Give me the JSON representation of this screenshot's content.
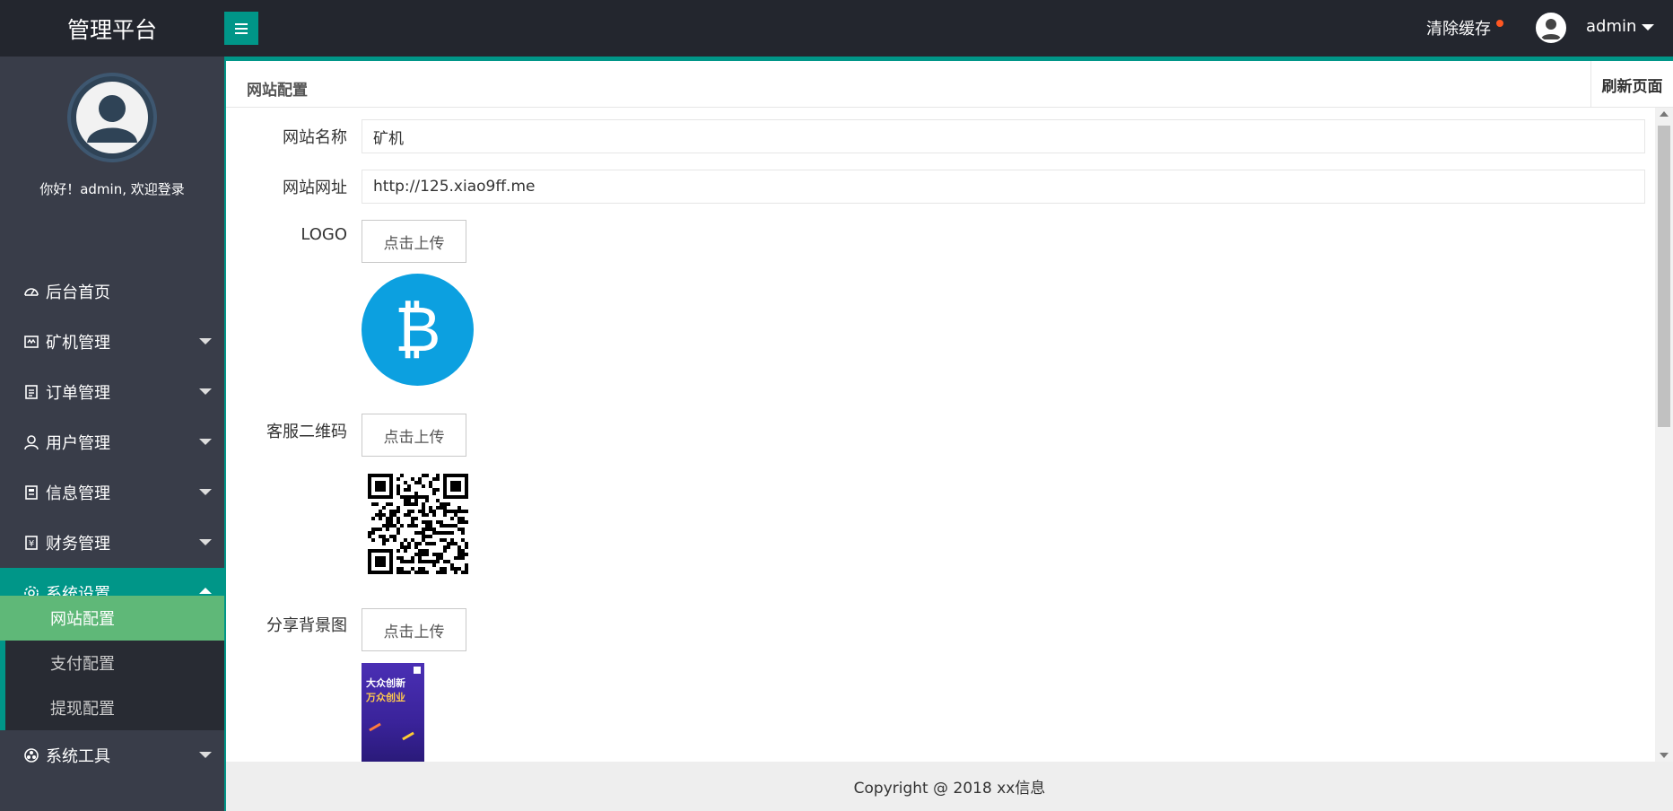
{
  "header": {
    "brand": "管理平台",
    "clear_cache": "清除缓存",
    "username": "admin",
    "menu_icon": "hamburger-icon",
    "accent_color": "#009688"
  },
  "sidebar": {
    "welcome": "你好！admin, 欢迎登录",
    "items": [
      {
        "label": "后台首页",
        "icon": "dashboard-icon"
      },
      {
        "label": "矿机管理",
        "icon": "miner-icon"
      },
      {
        "label": "订单管理",
        "icon": "order-icon"
      },
      {
        "label": "用户管理",
        "icon": "user-icon"
      },
      {
        "label": "信息管理",
        "icon": "info-icon"
      },
      {
        "label": "财务管理",
        "icon": "finance-icon"
      },
      {
        "label": "系统设置",
        "icon": "gear-icon"
      },
      {
        "label": "系统工具",
        "icon": "tools-icon"
      }
    ],
    "subitems": [
      {
        "label": "网站配置"
      },
      {
        "label": "支付配置"
      },
      {
        "label": "提现配置"
      }
    ]
  },
  "tab": {
    "title": "网站配置",
    "refresh": "刷新页面"
  },
  "form": {
    "site_name_label": "网站名称",
    "site_name_value": "矿机",
    "site_url_label": "网站网址",
    "site_url_value": "http://125.xiao9ff.me",
    "logo_label": "LOGO",
    "qr_label": "客服二维码",
    "share_bg_label": "分享背景图",
    "upload_label": "点击上传",
    "poster_line1": "大众创新",
    "poster_line2": "万众创业"
  },
  "footer": {
    "copyright": "Copyright @ 2018 xx信息"
  }
}
